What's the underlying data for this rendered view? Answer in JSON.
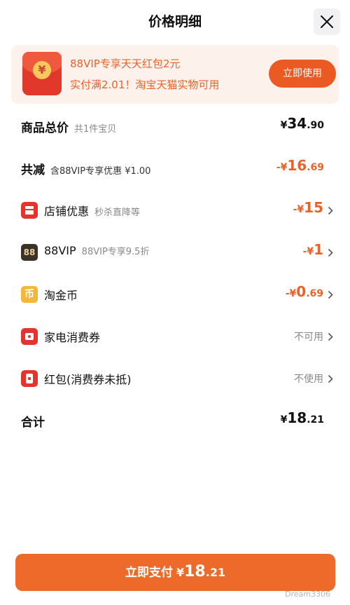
{
  "header": {
    "title": "价格明细"
  },
  "banner": {
    "line1": "88VIP专享天天红包2元",
    "line2": "实付满2.01！淘宝天猫实物可用",
    "button": "立即使用",
    "envelope_symbol": "¥"
  },
  "rows": {
    "total_price": {
      "label": "商品总价",
      "sub": "共1件宝贝",
      "currency": "¥",
      "int": "34",
      "dec": ".90"
    },
    "total_reduce": {
      "label": "共减",
      "sub": "含88VIP专享优惠 ¥1.00",
      "currency": "-¥",
      "int": "16",
      "dec": ".69"
    },
    "shop_discount": {
      "label": "店铺优惠",
      "sub": "秒杀直降等",
      "currency": "-¥",
      "int": "15",
      "dec": ""
    },
    "vip": {
      "label": "88VIP",
      "sub": "88VIP专享9.5折",
      "currency": "-¥",
      "int": "1",
      "dec": "",
      "icon_text": "88"
    },
    "coin": {
      "label": "淘金币",
      "currency": "-¥",
      "int": "0",
      "dec": ".69",
      "icon_text": "币"
    },
    "appliance": {
      "label": "家电消费券",
      "status": "不可用"
    },
    "red_packet": {
      "label": "红包(消费券未抵)",
      "status": "不使用"
    },
    "sum": {
      "label": "合计",
      "currency": "¥",
      "int": "18",
      "dec": ".21"
    }
  },
  "pay_button": {
    "label": "立即支付",
    "currency": "¥",
    "int": "18",
    "dec": ".21"
  },
  "watermark": "Dream3306",
  "colors": {
    "accent": "#ea5a22",
    "discount": "#e8632b",
    "banner_bg": "#fdf1ec",
    "pay": "#ee6a2a"
  }
}
